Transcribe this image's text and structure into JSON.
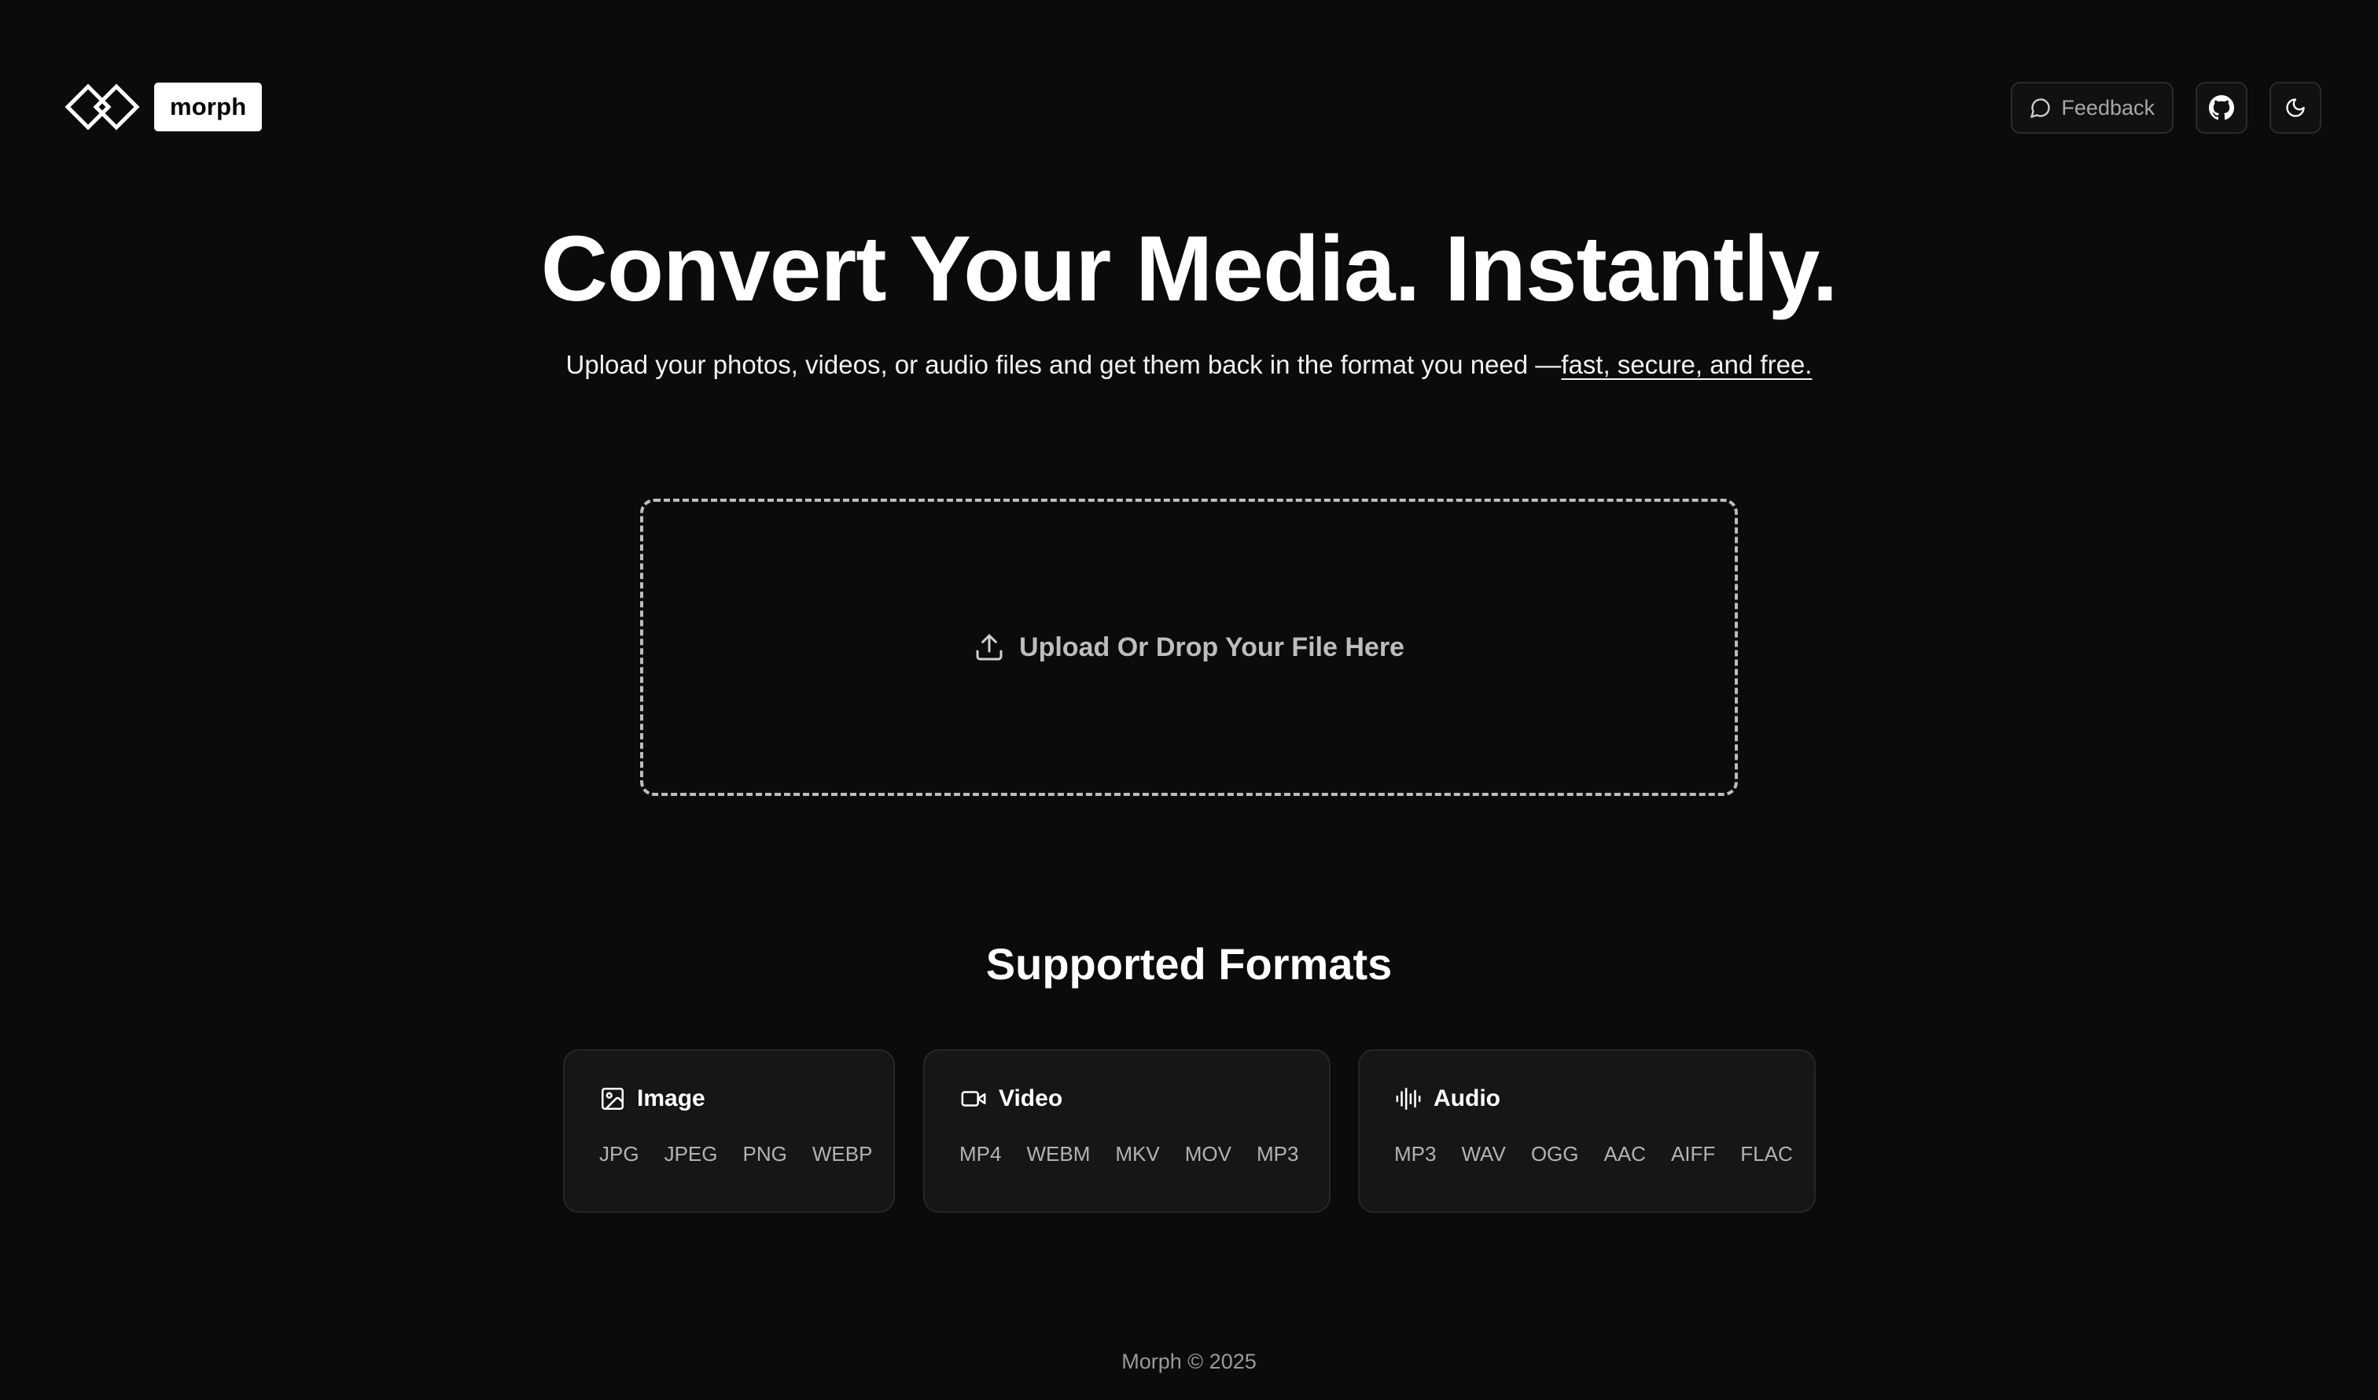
{
  "header": {
    "logo_text": "morph",
    "feedback_label": "Feedback"
  },
  "hero": {
    "title": "Convert Your Media. Instantly.",
    "subtitle": "Upload your photos, videos, or audio files and get them back in the format you need —",
    "subtitle_link": "fast, secure, and free."
  },
  "dropzone": {
    "label": "Upload Or Drop Your File Here"
  },
  "formats": {
    "title": "Supported Formats",
    "categories": [
      {
        "name": "Image",
        "icon": "image-icon",
        "items": [
          "JPG",
          "JPEG",
          "PNG",
          "WEBP"
        ]
      },
      {
        "name": "Video",
        "icon": "video-icon",
        "items": [
          "MP4",
          "WEBM",
          "MKV",
          "MOV",
          "MP3"
        ]
      },
      {
        "name": "Audio",
        "icon": "audio-waveform-icon",
        "items": [
          "MP3",
          "WAV",
          "OGG",
          "AAC",
          "AIFF",
          "FLAC"
        ]
      }
    ]
  },
  "footer": {
    "text": "Morph © 2025"
  },
  "colors": {
    "background": "#0b0b0b",
    "card_background": "#161616",
    "text_primary": "#ffffff",
    "text_muted": "#b3b3b3"
  }
}
